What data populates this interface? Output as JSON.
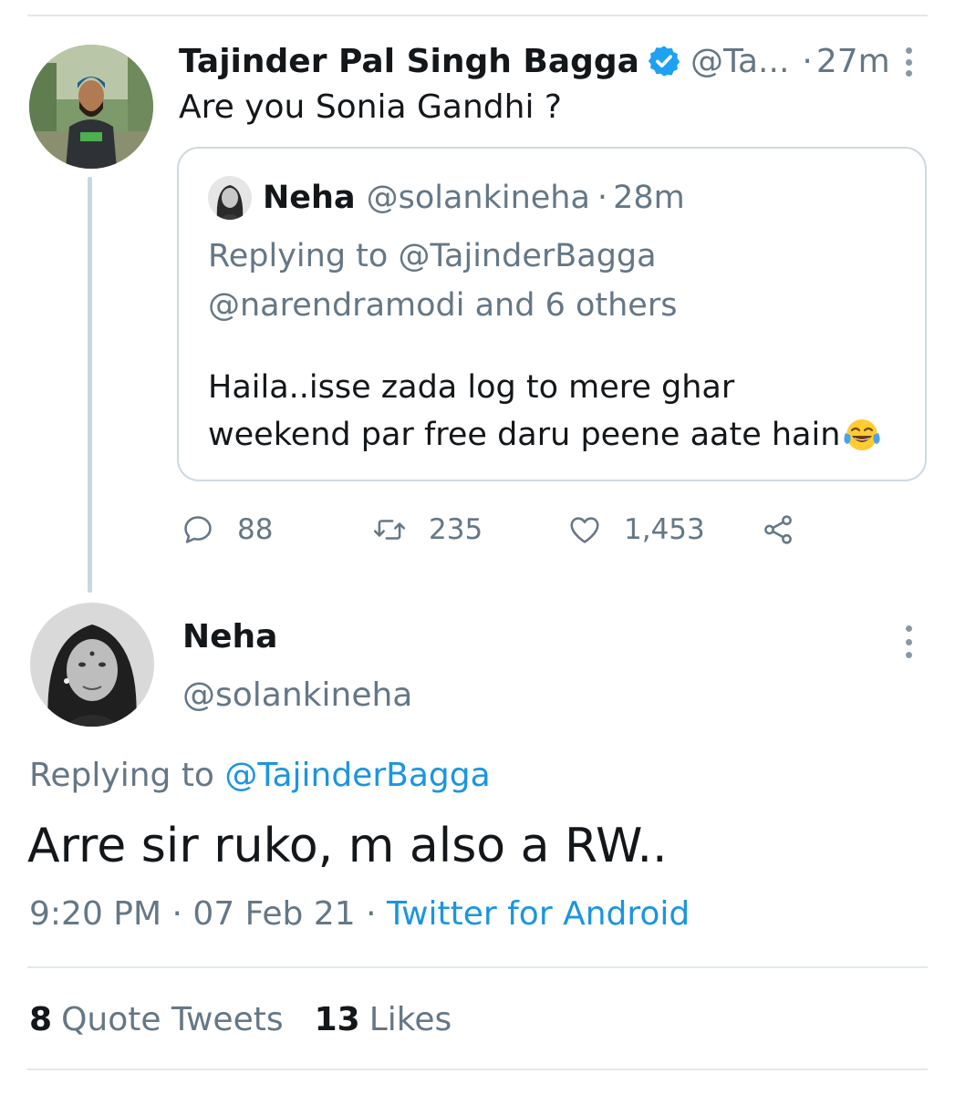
{
  "parent_tweet": {
    "author_name": "Tajinder Pal Singh Bagga",
    "handle": "@Ta...",
    "separator": "·",
    "time": "27m",
    "text": "Are you Sonia Gandhi ?",
    "verified_icon": "verified-badge-icon",
    "more_icon": "more-vertical-icon",
    "quoted_tweet": {
      "author_name": "Neha",
      "handle": "@solankineha",
      "separator": "·",
      "time": "28m",
      "replying_line1": "Replying to @TajinderBagga",
      "replying_line2": "@narendramodi and 6 others",
      "text_line1": "Haila..isse zada log to mere ghar",
      "text_line2": "weekend par free daru peene aate hain",
      "emoji": "face-with-tears-of-joy-emoji"
    },
    "actions": {
      "replies": "88",
      "retweets": "235",
      "likes": "1,453"
    }
  },
  "main_tweet": {
    "author_name": "Neha",
    "handle": "@solankineha",
    "replying_prefix": "Replying to",
    "replying_mention": "@TajinderBagga",
    "text": "Arre sir ruko, m also a RW..",
    "time": "9:20 PM",
    "date": "07 Feb 21",
    "separator": "·",
    "source": "Twitter for Android",
    "more_icon": "more-vertical-icon"
  },
  "stats": {
    "quote_tweets_count": "8",
    "quote_tweets_label": "Quote Tweets",
    "likes_count": "13",
    "likes_label": "Likes"
  },
  "colors": {
    "link_blue": "#1b95e0",
    "secondary_text": "#657786",
    "primary_text": "#14171a",
    "border": "#cfd9de",
    "verified_blue": "#1da1f2"
  }
}
